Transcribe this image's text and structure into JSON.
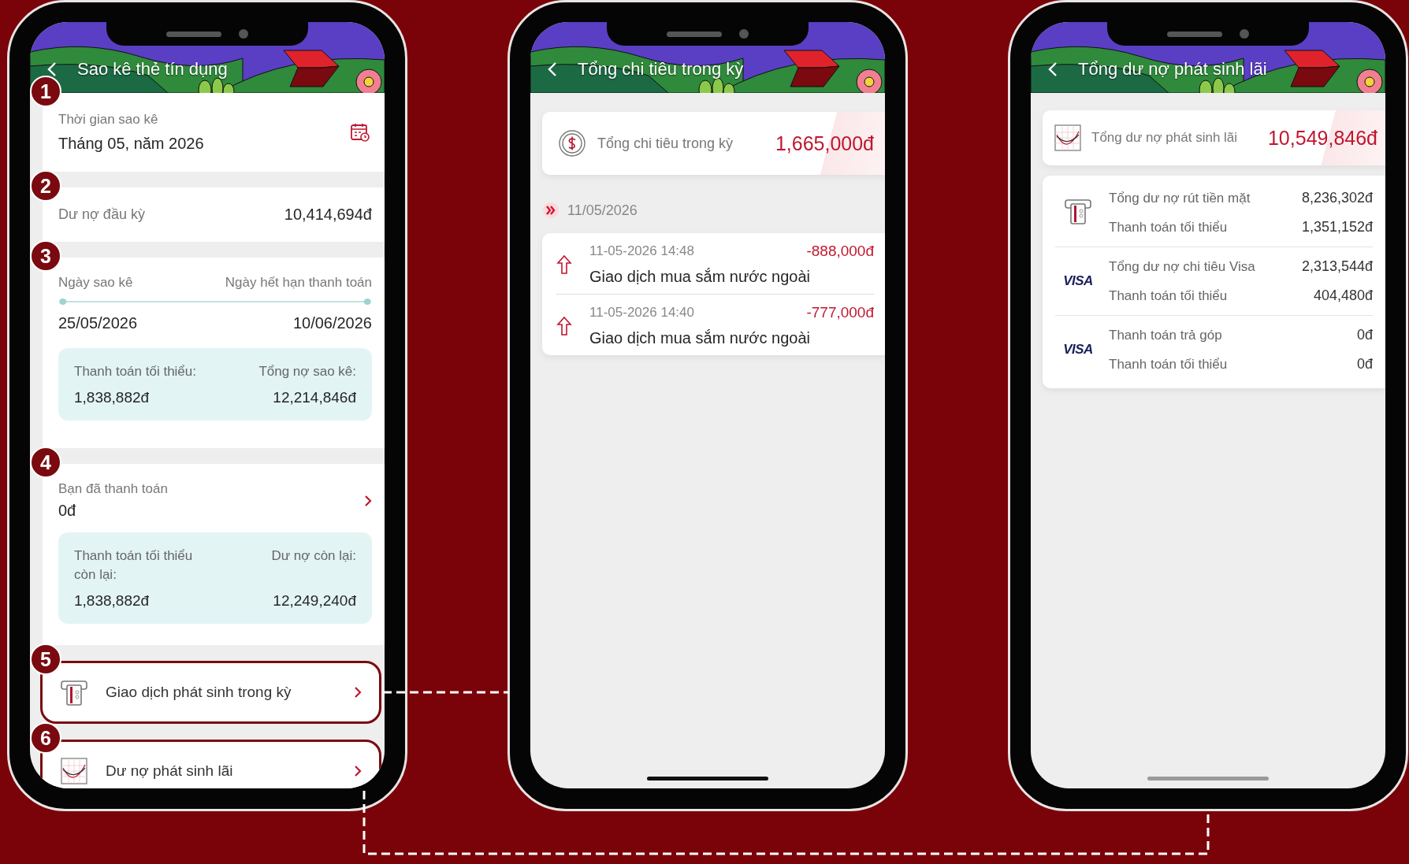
{
  "left_screen": {
    "title": "Sao kê thẻ tín dụng",
    "sections": [
      {
        "badge": "1",
        "kind": "period",
        "label": "Thời gian sao kê",
        "value": "Tháng 05, năm 2026",
        "highlighted": false
      },
      {
        "badge": "2",
        "kind": "balance",
        "label": "Dư nợ đầu kỳ",
        "value": "10,414,694đ",
        "highlighted": false
      },
      {
        "badge": "3",
        "kind": "dates",
        "start_label": "Ngày sao kê",
        "end_label": "Ngày hết hạn thanh toán",
        "start_date": "25/05/2026",
        "end_date": "10/06/2026",
        "summary": [
          {
            "label": "Thanh toán tối thiểu:",
            "value": "1,838,882đ"
          },
          {
            "label": "Tổng nợ sao kê:",
            "value": "12,214,846đ"
          }
        ],
        "highlighted": false
      },
      {
        "badge": "4",
        "kind": "paid",
        "label": "Bạn đã thanh toán",
        "value": "0đ",
        "summary": [
          {
            "label": "Thanh toán tối thiểu còn lại:",
            "value": "1,838,882đ"
          },
          {
            "label": "Dư nợ còn lại:",
            "value": "12,249,240đ"
          }
        ],
        "highlighted": false
      },
      {
        "badge": "5",
        "kind": "cash",
        "label": "Giao dịch phát sinh trong kỳ",
        "highlighted": true
      },
      {
        "badge": "6",
        "kind": "interest",
        "label": "Dư nợ phát sinh lãi",
        "highlighted": true
      }
    ]
  },
  "middle_screen": {
    "title": "Tổng chi tiêu trong kỳ",
    "summary": {
      "label": "Tổng chi tiêu trong kỳ",
      "amount": "1,665,000đ"
    },
    "date": "11/05/2026",
    "transactions": [
      {
        "time": "11-05-2026 14:48",
        "amount": "-888,000đ",
        "description": "Giao dịch mua sắm nước ngoài"
      },
      {
        "time": "11-05-2026 14:40",
        "amount": "-777,000đ",
        "description": "Giao dịch mua sắm nước ngoài"
      }
    ]
  },
  "right_screen": {
    "title": "Tổng dư nợ phát sinh lãi",
    "summary": {
      "label": "Tổng dư nợ phát sinh lãi",
      "amount": "10,549,846đ"
    },
    "groups": [
      {
        "kind": "cash",
        "rows": [
          {
            "label": "Tổng dư nợ rút tiền mặt",
            "value": "8,236,302đ"
          },
          {
            "label": "Thanh toán tối thiểu",
            "value": "1,351,152đ"
          }
        ]
      },
      {
        "kind": "visa",
        "logo": "VISA",
        "rows": [
          {
            "label": "Tổng dư nợ chi tiêu Visa",
            "value": "2,313,544đ"
          },
          {
            "label": "Thanh toán tối thiểu",
            "value": "404,480đ"
          }
        ]
      },
      {
        "kind": "visa",
        "logo": "VISA",
        "rows": [
          {
            "label": "Thanh toán trả góp",
            "value": "0đ"
          },
          {
            "label": "Thanh toán tối thiểu",
            "value": "0đ"
          }
        ]
      }
    ]
  }
}
